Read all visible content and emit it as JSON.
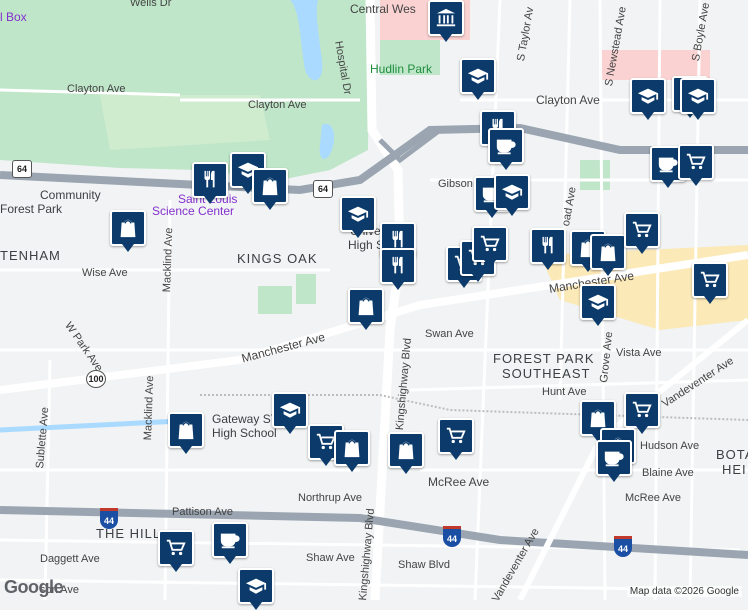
{
  "map": {
    "neighborhoods": {
      "kings_oak": "KINGS OAK",
      "tenham": "TENHAM",
      "forest_park_se_1": "FOREST PARK",
      "forest_park_se_2": "SOUTHEAST",
      "the_hill": "THE HILL",
      "bota": "BOTA",
      "hei": "HEI"
    },
    "streets": {
      "wells": "Wells Dr",
      "clayton_w": "Clayton Ave",
      "clayton_mid": "Clayton Ave",
      "clayton_e": "Clayton Ave",
      "central_west": "Central Wes",
      "hospital": "Hospital Dr",
      "taylor": "S Taylor Av",
      "newstead": "S Newstead Ave",
      "boyle": "S Boyle Ave",
      "gibson": "Gibson Ave",
      "wise": "Wise Ave",
      "w_park": "W Park Ave",
      "manchester_w": "Manchester Ave",
      "manchester_e": "Manchester Ave",
      "swan": "Swan Ave",
      "kingshighway_n": "S Kingshighway Blvd",
      "kingshighway_s": "Kingshighway Blvd",
      "mackind_n": "Macklind Ave",
      "mackind_s": "Macklind Ave",
      "sublette": "Sublette Ave",
      "vista": "Vista Ave",
      "vandeventer_n": "Vandeventer Ave",
      "vandeventer_s": "Vandeventer Ave",
      "hunt": "Hunt Ave",
      "grove": "Grove Ave",
      "mcree_w": "McRee Ave",
      "mcree_e": "McRee Ave",
      "northrup": "Northrup Ave",
      "pattison": "Pattison Ave",
      "shaw_w": "Shaw Ave",
      "shaw_blvd": "Shaw Blvd",
      "daggett": "Daggett Ave",
      "hudson": "Hudson Ave",
      "blaine": "Blaine Ave",
      "son": "son Ave",
      "road": "oad Ave"
    },
    "places": {
      "hudlin_park": "Hudlin Park",
      "science_center_1": "Saint Louis",
      "science_center_2": "Science Center",
      "community_1": "Community",
      "community_2": "Forest Park",
      "university_1": "University",
      "university_2": "High School",
      "gateway_1": "Gateway STEM",
      "gateway_2": "High School",
      "box": "l Box"
    },
    "route_shields": {
      "i64_w": "64",
      "i64_mid": "64",
      "us100": "100",
      "i44_w": "44",
      "i44_mid": "44",
      "i44_e": "44"
    },
    "pins": [
      {
        "type": "museum-icon"
      },
      {
        "type": "restaurant-icon"
      },
      {
        "type": "school-icon"
      },
      {
        "type": "shopping-bag-icon"
      },
      {
        "type": "shopping-bag-icon"
      },
      {
        "type": "school-icon"
      },
      {
        "type": "restaurant-icon"
      },
      {
        "type": "restaurant-icon"
      },
      {
        "type": "shopping-bag-icon"
      },
      {
        "type": "school-icon"
      },
      {
        "type": "restaurant-icon"
      },
      {
        "type": "coffee-icon"
      },
      {
        "type": "coffee-icon"
      },
      {
        "type": "school-icon"
      },
      {
        "type": "shopping-cart-icon"
      },
      {
        "type": "shopping-cart-icon"
      },
      {
        "type": "restaurant-icon"
      },
      {
        "type": "shopping-bag-icon"
      },
      {
        "type": "shopping-bag-icon"
      },
      {
        "type": "shopping-cart-icon"
      },
      {
        "type": "shopping-cart-icon"
      },
      {
        "type": "school-icon"
      },
      {
        "type": "coffee-icon"
      },
      {
        "type": "shopping-cart-icon"
      },
      {
        "type": "school-icon"
      },
      {
        "type": "coffee-icon"
      },
      {
        "type": "shopping-bag-icon"
      },
      {
        "type": "shopping-cart-icon"
      },
      {
        "type": "school-icon"
      },
      {
        "type": "shopping-bag-icon"
      },
      {
        "type": "shopping-cart-icon"
      },
      {
        "type": "shopping-bag-icon"
      },
      {
        "type": "shopping-bag-icon"
      },
      {
        "type": "shopping-cart-icon"
      },
      {
        "type": "shopping-cart-icon"
      },
      {
        "type": "school-icon"
      },
      {
        "type": "shopping-bag-icon"
      },
      {
        "type": "coffee-icon"
      },
      {
        "type": "shopping-cart-icon"
      },
      {
        "type": "coffee-icon"
      },
      {
        "type": "school-icon"
      }
    ],
    "attribution": "Map data ©2026 Google",
    "logo": "Google"
  },
  "colors": {
    "park": "#bfe6c9",
    "road": "#ffffff",
    "highway": "#9aa5b1",
    "pin": "#0b3a6b",
    "commercial": "#fbe9b7",
    "hospital": "#fad2d2",
    "water": "#aadaff"
  }
}
